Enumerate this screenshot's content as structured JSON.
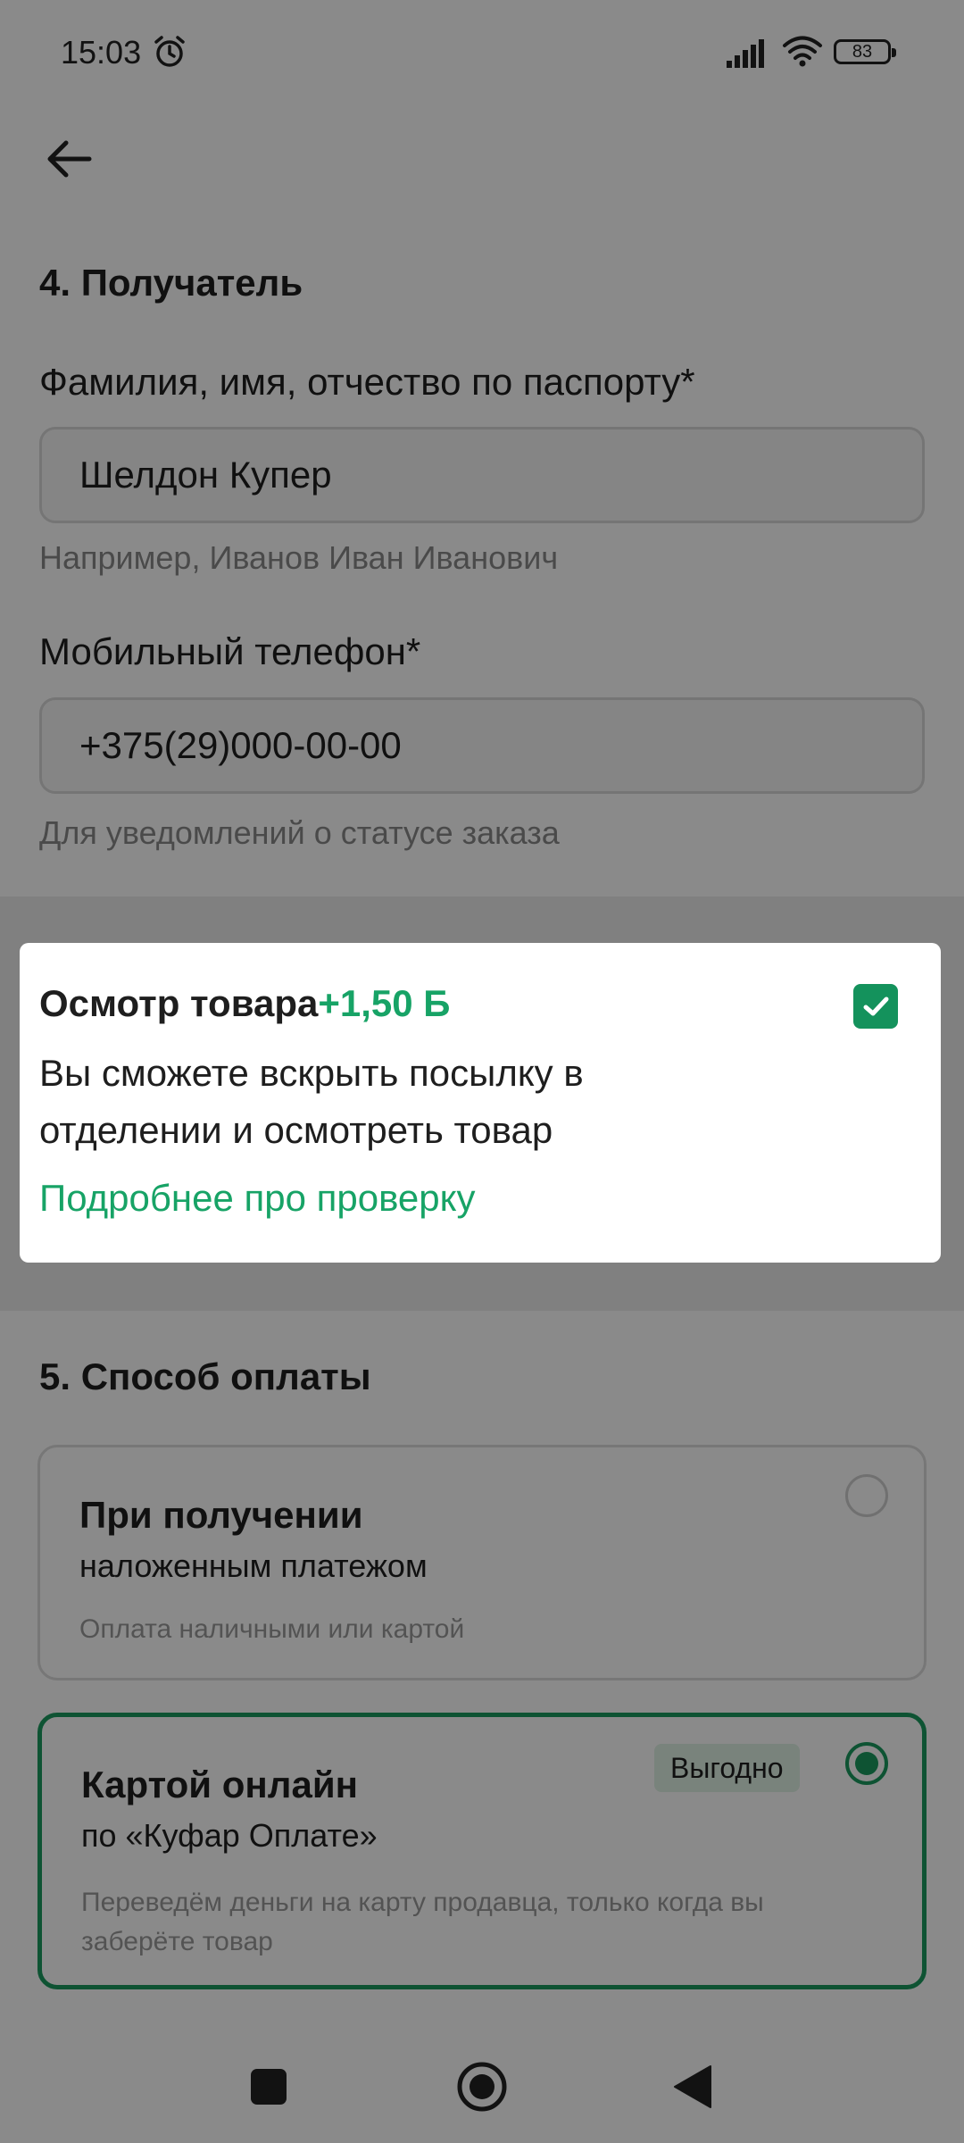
{
  "status_bar": {
    "time": "15:03",
    "battery": "83"
  },
  "recipient": {
    "section_title": "4. Получатель",
    "name_label": "Фамилия, имя, отчество по паспорту*",
    "name_value": "Шелдон Купер",
    "name_hint": "Например, Иванов Иван Иванович",
    "phone_label": "Мобильный телефон*",
    "phone_value": "+375(29)000-00-00",
    "phone_hint": "Для уведомлений о статусе заказа"
  },
  "inspection": {
    "title": "Осмотр товара",
    "price": "+1,50 Б",
    "checked": true,
    "description": "Вы сможете вскрыть посылку в отделении и осмотреть товар",
    "link": "Подробнее про проверку"
  },
  "payment": {
    "section_title": "5. Способ оплаты",
    "options": [
      {
        "title": "При получении",
        "subtitle": "наложенным платежом",
        "note": "Оплата наличными или картой",
        "selected": false
      },
      {
        "title": "Картой онлайн",
        "subtitle": "по «Куфар Оплате»",
        "note": "Переведём деньги на карту продавца, только когда вы заберёте товар",
        "badge": "Выгодно",
        "selected": true
      }
    ]
  },
  "colors": {
    "accent_green": "#17a366",
    "selected_border": "#1a9a5e",
    "badge_bg": "#dff3e6"
  },
  "icons": [
    "alarm-icon",
    "signal-icon",
    "wifi-icon",
    "back-arrow-icon",
    "checkmark-icon",
    "nav-square-icon",
    "nav-home-icon",
    "nav-back-icon"
  ]
}
